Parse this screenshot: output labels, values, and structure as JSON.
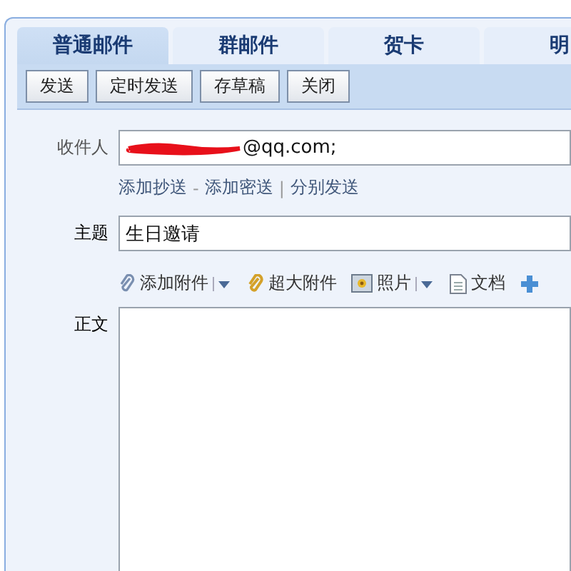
{
  "tabs": [
    {
      "label": "普通邮件",
      "selected": true
    },
    {
      "label": "群邮件",
      "selected": false
    },
    {
      "label": "贺卡",
      "selected": false
    },
    {
      "label": "明",
      "selected": false
    }
  ],
  "toolbar_buttons": [
    "发送",
    "定时发送",
    "存草稿",
    "关闭"
  ],
  "recipient": {
    "label": "收件人",
    "value": "@qq.com;",
    "redacted": true
  },
  "recipient_links": [
    {
      "kind": "link",
      "label": "添加抄送"
    },
    {
      "kind": "separator",
      "label": "-"
    },
    {
      "kind": "link",
      "label": "添加密送"
    },
    {
      "kind": "separator",
      "label": "|"
    },
    {
      "kind": "link",
      "label": "分别发送"
    }
  ],
  "subject": {
    "label": "主题",
    "value": "生日邀请"
  },
  "attach_tools": [
    {
      "kind": "clip",
      "label": "添加附件",
      "menu": true
    },
    {
      "kind": "bigclip",
      "label": "超大附件",
      "menu": false
    },
    {
      "kind": "photo",
      "label": "照片",
      "menu": true
    },
    {
      "kind": "doc",
      "label": "文档",
      "menu": false
    },
    {
      "kind": "more",
      "menu": false
    }
  ],
  "body": {
    "label": "正文"
  }
}
